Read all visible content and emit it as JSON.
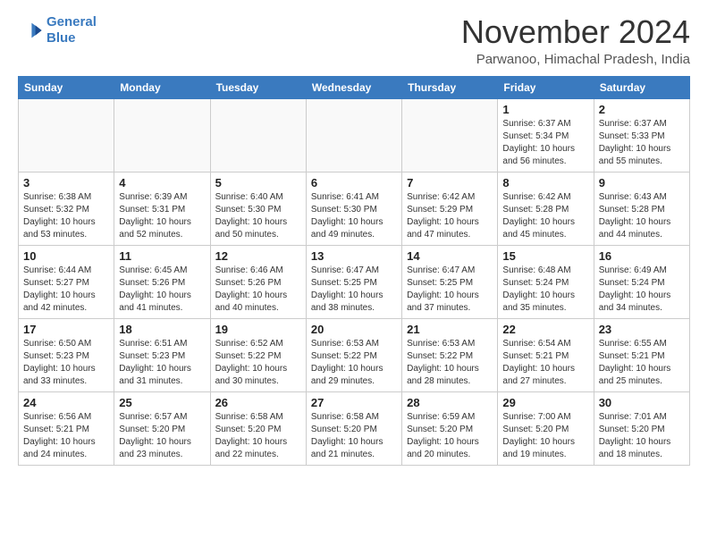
{
  "header": {
    "logo_line1": "General",
    "logo_line2": "Blue",
    "month_title": "November 2024",
    "location": "Parwanoo, Himachal Pradesh, India"
  },
  "weekdays": [
    "Sunday",
    "Monday",
    "Tuesday",
    "Wednesday",
    "Thursday",
    "Friday",
    "Saturday"
  ],
  "weeks": [
    [
      {
        "day": "",
        "info": ""
      },
      {
        "day": "",
        "info": ""
      },
      {
        "day": "",
        "info": ""
      },
      {
        "day": "",
        "info": ""
      },
      {
        "day": "",
        "info": ""
      },
      {
        "day": "1",
        "info": "Sunrise: 6:37 AM\nSunset: 5:34 PM\nDaylight: 10 hours and 56 minutes."
      },
      {
        "day": "2",
        "info": "Sunrise: 6:37 AM\nSunset: 5:33 PM\nDaylight: 10 hours and 55 minutes."
      }
    ],
    [
      {
        "day": "3",
        "info": "Sunrise: 6:38 AM\nSunset: 5:32 PM\nDaylight: 10 hours and 53 minutes."
      },
      {
        "day": "4",
        "info": "Sunrise: 6:39 AM\nSunset: 5:31 PM\nDaylight: 10 hours and 52 minutes."
      },
      {
        "day": "5",
        "info": "Sunrise: 6:40 AM\nSunset: 5:30 PM\nDaylight: 10 hours and 50 minutes."
      },
      {
        "day": "6",
        "info": "Sunrise: 6:41 AM\nSunset: 5:30 PM\nDaylight: 10 hours and 49 minutes."
      },
      {
        "day": "7",
        "info": "Sunrise: 6:42 AM\nSunset: 5:29 PM\nDaylight: 10 hours and 47 minutes."
      },
      {
        "day": "8",
        "info": "Sunrise: 6:42 AM\nSunset: 5:28 PM\nDaylight: 10 hours and 45 minutes."
      },
      {
        "day": "9",
        "info": "Sunrise: 6:43 AM\nSunset: 5:28 PM\nDaylight: 10 hours and 44 minutes."
      }
    ],
    [
      {
        "day": "10",
        "info": "Sunrise: 6:44 AM\nSunset: 5:27 PM\nDaylight: 10 hours and 42 minutes."
      },
      {
        "day": "11",
        "info": "Sunrise: 6:45 AM\nSunset: 5:26 PM\nDaylight: 10 hours and 41 minutes."
      },
      {
        "day": "12",
        "info": "Sunrise: 6:46 AM\nSunset: 5:26 PM\nDaylight: 10 hours and 40 minutes."
      },
      {
        "day": "13",
        "info": "Sunrise: 6:47 AM\nSunset: 5:25 PM\nDaylight: 10 hours and 38 minutes."
      },
      {
        "day": "14",
        "info": "Sunrise: 6:47 AM\nSunset: 5:25 PM\nDaylight: 10 hours and 37 minutes."
      },
      {
        "day": "15",
        "info": "Sunrise: 6:48 AM\nSunset: 5:24 PM\nDaylight: 10 hours and 35 minutes."
      },
      {
        "day": "16",
        "info": "Sunrise: 6:49 AM\nSunset: 5:24 PM\nDaylight: 10 hours and 34 minutes."
      }
    ],
    [
      {
        "day": "17",
        "info": "Sunrise: 6:50 AM\nSunset: 5:23 PM\nDaylight: 10 hours and 33 minutes."
      },
      {
        "day": "18",
        "info": "Sunrise: 6:51 AM\nSunset: 5:23 PM\nDaylight: 10 hours and 31 minutes."
      },
      {
        "day": "19",
        "info": "Sunrise: 6:52 AM\nSunset: 5:22 PM\nDaylight: 10 hours and 30 minutes."
      },
      {
        "day": "20",
        "info": "Sunrise: 6:53 AM\nSunset: 5:22 PM\nDaylight: 10 hours and 29 minutes."
      },
      {
        "day": "21",
        "info": "Sunrise: 6:53 AM\nSunset: 5:22 PM\nDaylight: 10 hours and 28 minutes."
      },
      {
        "day": "22",
        "info": "Sunrise: 6:54 AM\nSunset: 5:21 PM\nDaylight: 10 hours and 27 minutes."
      },
      {
        "day": "23",
        "info": "Sunrise: 6:55 AM\nSunset: 5:21 PM\nDaylight: 10 hours and 25 minutes."
      }
    ],
    [
      {
        "day": "24",
        "info": "Sunrise: 6:56 AM\nSunset: 5:21 PM\nDaylight: 10 hours and 24 minutes."
      },
      {
        "day": "25",
        "info": "Sunrise: 6:57 AM\nSunset: 5:20 PM\nDaylight: 10 hours and 23 minutes."
      },
      {
        "day": "26",
        "info": "Sunrise: 6:58 AM\nSunset: 5:20 PM\nDaylight: 10 hours and 22 minutes."
      },
      {
        "day": "27",
        "info": "Sunrise: 6:58 AM\nSunset: 5:20 PM\nDaylight: 10 hours and 21 minutes."
      },
      {
        "day": "28",
        "info": "Sunrise: 6:59 AM\nSunset: 5:20 PM\nDaylight: 10 hours and 20 minutes."
      },
      {
        "day": "29",
        "info": "Sunrise: 7:00 AM\nSunset: 5:20 PM\nDaylight: 10 hours and 19 minutes."
      },
      {
        "day": "30",
        "info": "Sunrise: 7:01 AM\nSunset: 5:20 PM\nDaylight: 10 hours and 18 minutes."
      }
    ]
  ]
}
